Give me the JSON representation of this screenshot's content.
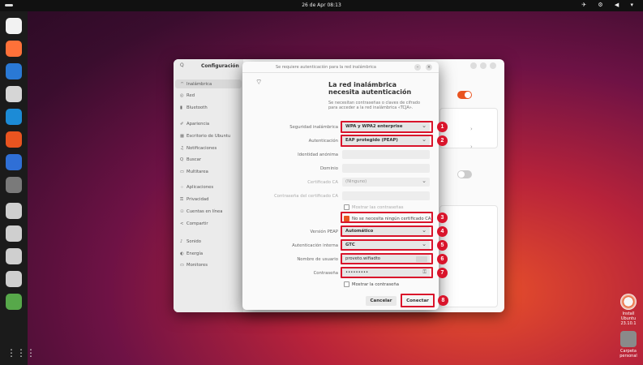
{
  "topbar": {
    "clock": "26 de Apr 08:13",
    "tray": "✈ ⚙ ◀ ▾"
  },
  "dock": {
    "icons": [
      {
        "name": "shotwell-icon",
        "color": "#f2f2f2"
      },
      {
        "name": "firefox-icon",
        "color": "#ff7139"
      },
      {
        "name": "thunderbird-icon",
        "color": "#2a79d5"
      },
      {
        "name": "files-icon",
        "color": "#d6d6d6"
      },
      {
        "name": "writer-icon",
        "color": "#1c8bd6"
      },
      {
        "name": "software-icon",
        "color": "#e95420"
      },
      {
        "name": "help-icon",
        "color": "#2f6fd6"
      },
      {
        "name": "settings-icon",
        "color": "#7a7a7a"
      },
      {
        "name": "storage-icon",
        "color": "#cfcfcf"
      },
      {
        "name": "storage-icon-2",
        "color": "#cfcfcf"
      },
      {
        "name": "storage-icon-3",
        "color": "#cfcfcf"
      },
      {
        "name": "storage-icon-4",
        "color": "#cfcfcf"
      },
      {
        "name": "installer-icon",
        "color": "#57a84a"
      }
    ],
    "apps_grid": "⋮⋮⋮"
  },
  "settings": {
    "title": "Configuración",
    "search_icon": "Q",
    "sidebar": [
      {
        "icon": "⌔",
        "label": "Inalámbrica"
      },
      {
        "icon": "◎",
        "label": "Red"
      },
      {
        "icon": "▮",
        "label": "Bluetooth"
      },
      {
        "icon": "✐",
        "label": "Apariencia"
      },
      {
        "icon": "▦",
        "label": "Escritorio de Ubuntu"
      },
      {
        "icon": "♫",
        "label": "Notificaciones"
      },
      {
        "icon": "Q",
        "label": "Buscar"
      },
      {
        "icon": "▭",
        "label": "Multitarea"
      },
      {
        "icon": "⁘",
        "label": "Aplicaciones"
      },
      {
        "icon": "⚿",
        "label": "Privacidad"
      },
      {
        "icon": "☉",
        "label": "Cuentas en línea"
      },
      {
        "icon": "<",
        "label": "Compartir"
      },
      {
        "icon": "♪",
        "label": "Sonido"
      },
      {
        "icon": "◐",
        "label": "Energía"
      },
      {
        "icon": "▭",
        "label": "Monitores"
      }
    ]
  },
  "dialog": {
    "title": "Se requiere autenticación para la red inalámbrica",
    "min_label": "–",
    "close_label": "×",
    "wifi_icon": "⌔",
    "heading": "La red inalámbrica necesita autenticación",
    "subtitle": "Se necesitan contraseñas o claves de cifrado para acceder a la red inalámbrica «TCJA».",
    "fields": {
      "security": {
        "label": "Seguridad inalámbrica",
        "value": "WPA y WPA2 enterprise"
      },
      "auth": {
        "label": "Autenticación",
        "value": "EAP protegido (PEAP)"
      },
      "anon_identity": {
        "label": "Identidad anónima",
        "value": ""
      },
      "domain": {
        "label": "Dominio",
        "value": ""
      },
      "ca_cert": {
        "label": "Certificado CA",
        "value": "(Ninguno)"
      },
      "ca_password": {
        "label": "Contraseña del certificado CA",
        "value": ""
      },
      "show_passwords": {
        "label": "Mostrar las contraseñas"
      },
      "no_ca": {
        "label": "No se necesita ningún certificado CA",
        "checked": true
      },
      "peap_version": {
        "label": "Versión PEAP",
        "value": "Automático"
      },
      "inner_auth": {
        "label": "Autenticación interna",
        "value": "GTC"
      },
      "username": {
        "label": "Nombre de usuario",
        "value": "proveto.wifiadto"
      },
      "password": {
        "label": "Contraseña",
        "value": "•••••••••",
        "icon": "⚿"
      },
      "show_password": {
        "label": "Mostrar la contraseña"
      }
    },
    "cancel_label": "Cancelar",
    "connect_label": "Conectar"
  },
  "annotations": {
    "color": "#d9142b",
    "badges": [
      "1",
      "2",
      "3",
      "4",
      "5",
      "6",
      "7",
      "8"
    ]
  },
  "desktop": {
    "install_label": "Install Ubuntu 23.10.1",
    "folder_label": "Carpeta personal"
  }
}
